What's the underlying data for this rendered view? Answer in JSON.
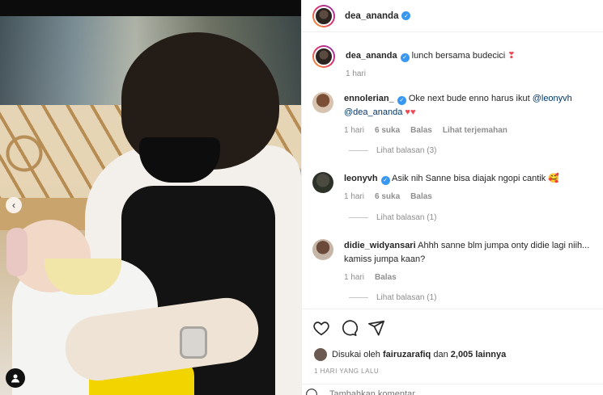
{
  "post": {
    "author": "dea_ananda",
    "caption": "lunch bersama budecici",
    "caption_emoji": "❣",
    "time": "1 hari"
  },
  "comments": [
    {
      "user": "ennolerian_",
      "verified": true,
      "text_before": "Oke next bude enno harus ikut",
      "mention1": "@leonyvh",
      "mention2": "@dea_ananda",
      "emoji": "♥♥",
      "time": "1 hari",
      "likes": "6 suka",
      "reply": "Balas",
      "translate": "Lihat terjemahan",
      "view_replies": "Lihat balasan (3)"
    },
    {
      "user": "leonyvh",
      "verified": true,
      "text": "Asik nih Sanne bisa diajak ngopi cantik",
      "emoji": "🥰",
      "time": "1 hari",
      "likes": "6 suka",
      "reply": "Balas",
      "view_replies": "Lihat balasan (1)"
    },
    {
      "user": "didie_widyansari",
      "verified": false,
      "text": "Ahhh sanne blm jumpa onty didie lagi niih... kamiss jumpa kaan?",
      "time": "1 hari",
      "reply": "Balas",
      "view_replies": "Lihat balasan (1)"
    }
  ],
  "likes": {
    "prefix": "Disukai oleh",
    "user": "fairuzarafiq",
    "joiner": "dan",
    "others": "2,005 lainnya"
  },
  "date_label": "1 HARI YANG LALU",
  "comment_input": {
    "placeholder": "Tambahkan komentar..."
  },
  "colors": {
    "verified": "#3897f0",
    "heart": "#ed4956",
    "muted": "#8e8e8e"
  }
}
